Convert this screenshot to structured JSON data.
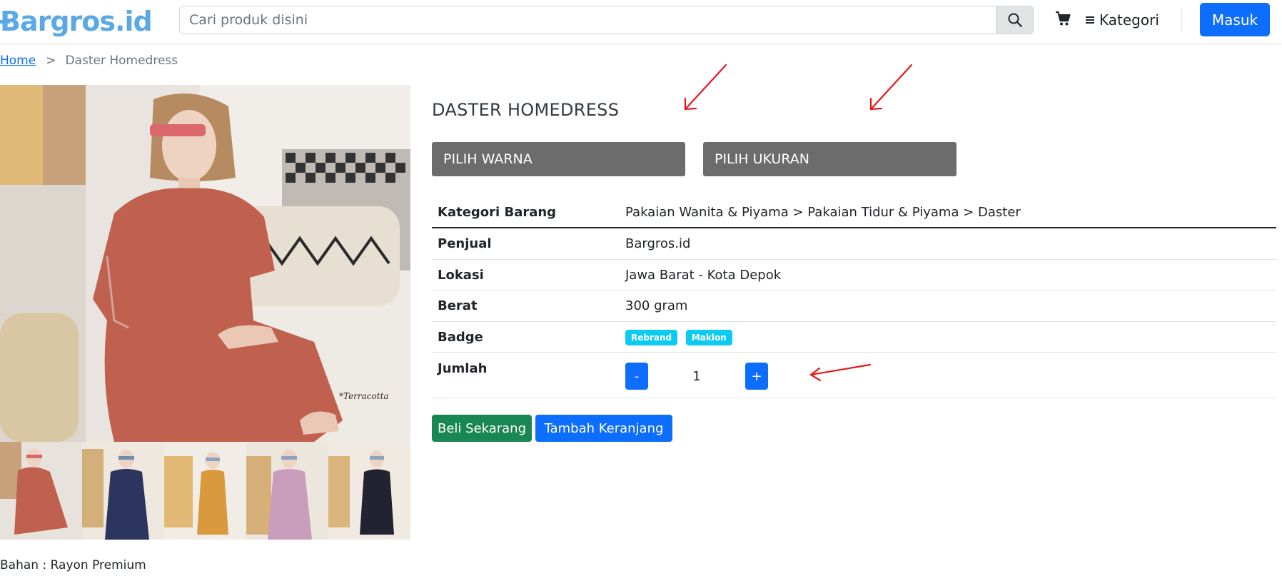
{
  "navbar": {
    "logo_text": "Bargros.id",
    "search_placeholder": "Cari produk disini",
    "kategori_label": "Kategori",
    "login_label": "Masuk"
  },
  "breadcrumb": {
    "home": "Home",
    "separator": ">",
    "current": "Daster Homedress"
  },
  "product": {
    "title": "DASTER HOMEDRESS",
    "main_image_caption": "*Terracotta",
    "thumbnails": [
      {
        "color": "#c0604e"
      },
      {
        "color": "#2c3560"
      },
      {
        "color": "#d99a3e"
      },
      {
        "color": "#c99dbc"
      },
      {
        "color": "#222230"
      }
    ],
    "pick_color_label": "PILIH WARNA",
    "pick_size_label": "PILIH UKURAN",
    "bahan": "Bahan : Rayon Premium"
  },
  "info_table": {
    "rows": [
      {
        "key": "Kategori Barang",
        "value": "Pakaian Wanita & Piyama > Pakaian Tidur & Piyama > Daster"
      },
      {
        "key": "Penjual",
        "value": "Bargros.id"
      },
      {
        "key": "Lokasi",
        "value": "Jawa Barat - Kota Depok"
      },
      {
        "key": "Berat",
        "value": "300 gram"
      },
      {
        "key": "Badge",
        "badges": [
          "Rebrand",
          "Maklon"
        ]
      },
      {
        "key": "Jumlah"
      }
    ]
  },
  "quantity": {
    "minus": "-",
    "value": "1",
    "plus": "+"
  },
  "actions": {
    "buy_now": "Beli Sekarang",
    "add_cart": "Tambah Keranjang"
  },
  "colors": {
    "primary": "#0d6efd",
    "success": "#198754",
    "info": "#0dcaf0",
    "pick_bg": "#6c6c6c",
    "logo": "#5aa9e6",
    "annotation_arrow": "#e8161b"
  }
}
